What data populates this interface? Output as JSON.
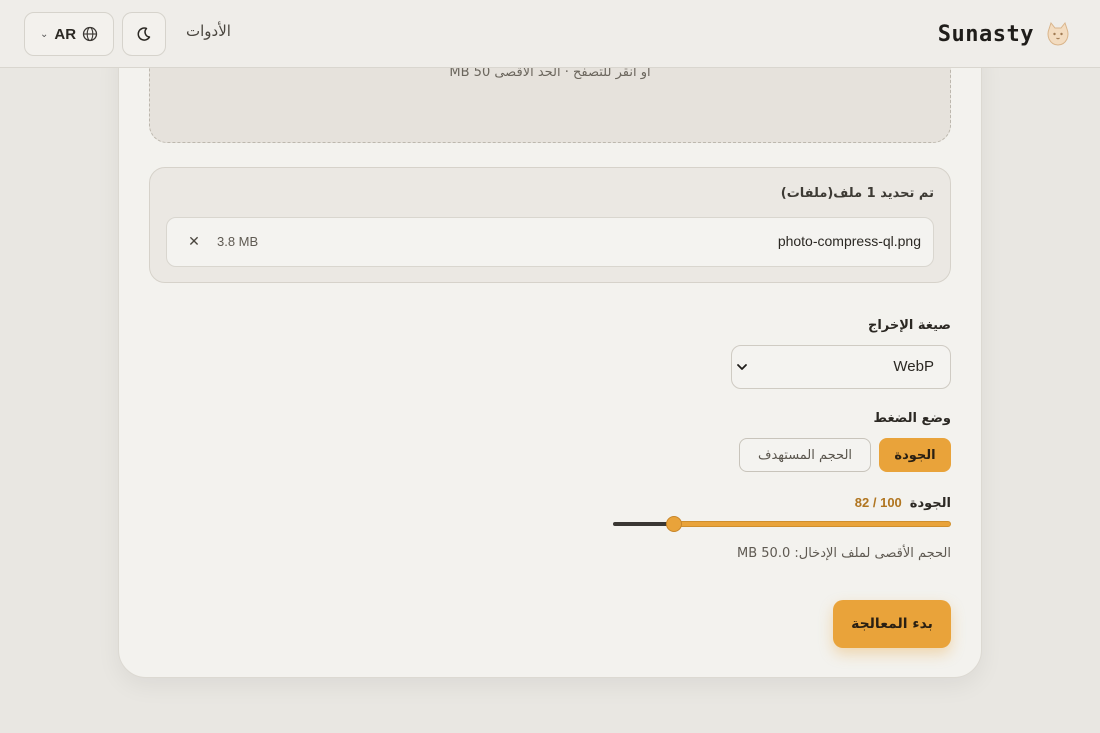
{
  "header": {
    "brand_name": "Sunasty",
    "tools_label": "الأدوات",
    "language_code": "AR",
    "icons": {
      "logo": "cat-logo-icon",
      "globe": "globe-icon",
      "chevron": "chevron-down-icon",
      "theme": "moon-icon"
    }
  },
  "upload": {
    "hint": "أو انقر للتصفح · الحد الأقصى 50 MB"
  },
  "files": {
    "count_label": "تم تحديد 1 ملف(ملفات)",
    "items": [
      {
        "name": "photo-compress-ql.png",
        "size": "3.8 MB",
        "remove_icon": "close-icon"
      }
    ]
  },
  "output_format": {
    "label": "صيغة الإخراج",
    "selected": "WebP"
  },
  "compression_mode": {
    "label": "وضع الضغط",
    "options": [
      "الجودة",
      "الحجم المستهدف"
    ],
    "active": "الجودة"
  },
  "quality": {
    "label": "الجودة",
    "value": 82,
    "max": 100,
    "display": "82 / 100"
  },
  "limits": {
    "max_input_size": "الحجم الأقصى لملف الإدخال: 50.0 MB"
  },
  "actions": {
    "start_label": "بدء  المعالجة"
  },
  "colors": {
    "accent": "#e9a33a",
    "accent_text": "#b07520",
    "background": "#e9e7e2",
    "card": "#f3f2ee"
  }
}
